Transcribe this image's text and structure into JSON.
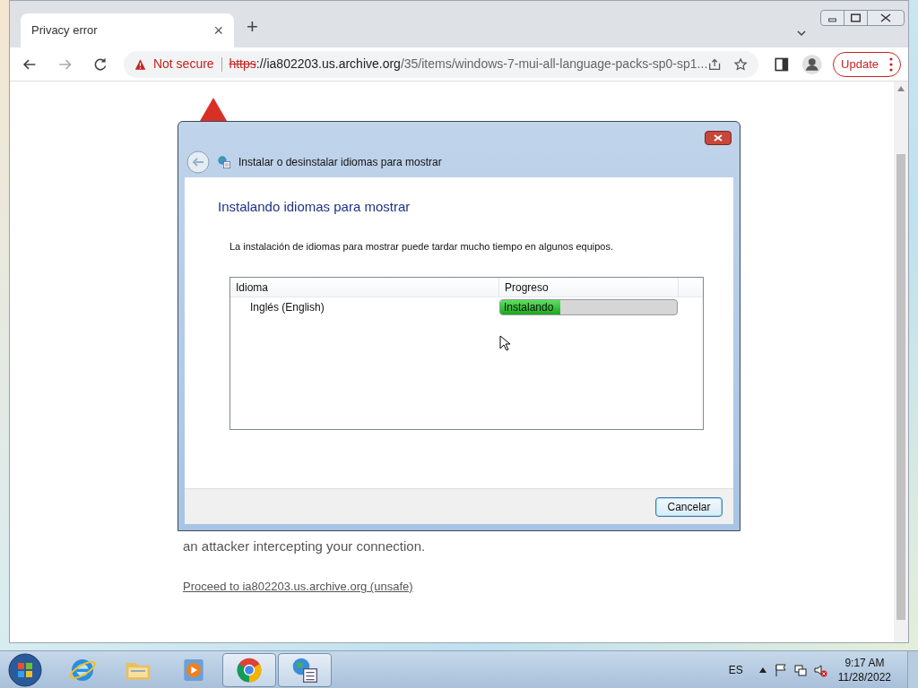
{
  "browser": {
    "tab": {
      "title": "Privacy error",
      "close": "×"
    },
    "new_tab": "+",
    "address": {
      "security": "Not secure",
      "url_scheme": "https",
      "url_host": "://ia802203.us.archive.org",
      "url_path": "/35/items/windows-7-mui-all-language-packs-sp0-sp1..."
    },
    "update_button": "Update"
  },
  "page": {
    "text": "an attacker intercepting your connection.",
    "link": "Proceed to ia802203.us.archive.org (unsafe)"
  },
  "dialog": {
    "title": "Instalar o desinstalar idiomas para mostrar",
    "heading": "Instalando idiomas para mostrar",
    "description": "La instalación de idiomas para mostrar puede tardar mucho tiempo en algunos equipos.",
    "columns": [
      "Idioma",
      "Progreso"
    ],
    "rows": [
      {
        "language": "Inglés (English)",
        "status": "Instalando",
        "level": 0.34
      }
    ],
    "cancel": "Cancelar"
  },
  "taskbar": {
    "items": [
      {
        "kind": "ie",
        "active": false
      },
      {
        "kind": "folder",
        "active": false
      },
      {
        "kind": "media",
        "active": false
      },
      {
        "kind": "chrome",
        "active": true
      },
      {
        "kind": "language",
        "active": true
      }
    ],
    "language": "ES",
    "time": "9:17 AM",
    "date": "11/28/2022"
  }
}
